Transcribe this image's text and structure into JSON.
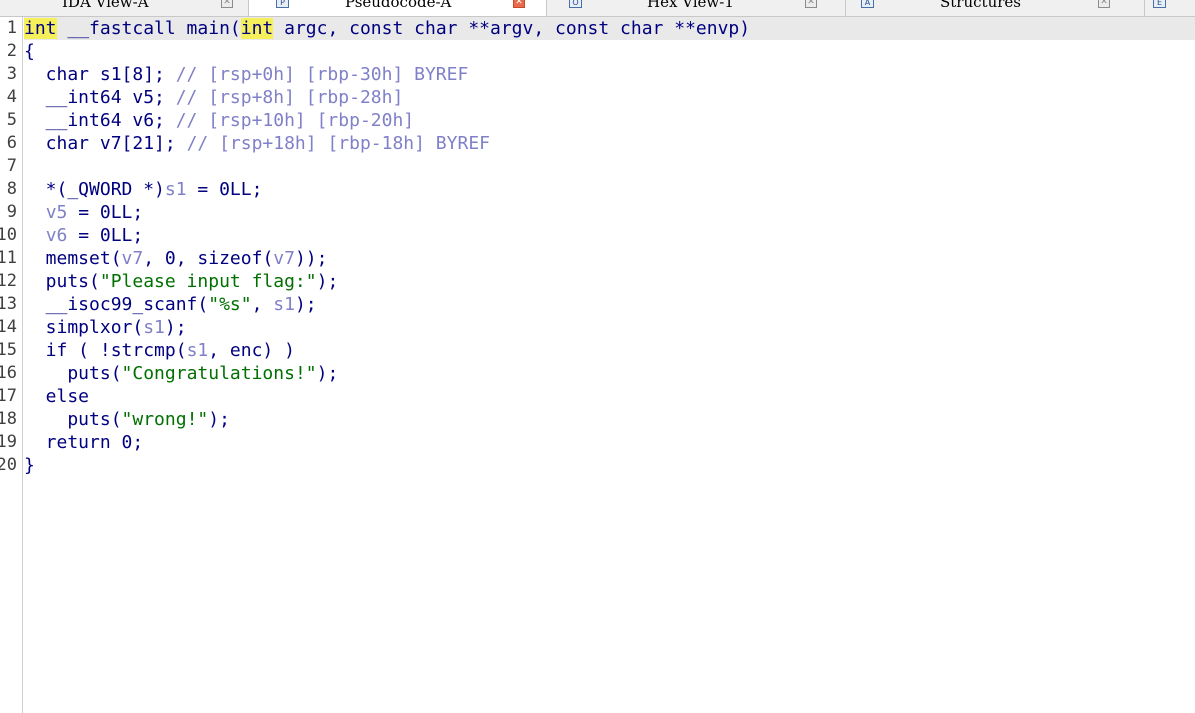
{
  "tabs": [
    {
      "label": "IDA View-A",
      "active": false
    },
    {
      "label": "Pseudocode-A",
      "active": true
    },
    {
      "label": "Hex View-1",
      "active": false
    },
    {
      "label": "Structures",
      "active": false
    }
  ],
  "tab_icons": {
    "pseudocode": "P",
    "hex": "O",
    "structures": "A",
    "enums": "E"
  },
  "colors": {
    "keyword": "#000080",
    "variable": "#8080c8",
    "string": "#007000",
    "highlight": "#f5f05a"
  },
  "line_numbers": [
    "1",
    "2",
    "3",
    "4",
    "5",
    "6",
    "7",
    "8",
    "9",
    "10",
    "11",
    "12",
    "13",
    "14",
    "15",
    "16",
    "17",
    "18",
    "19",
    "20"
  ],
  "code": {
    "l1": {
      "a": "int",
      "b": " __fastcall main(",
      "c": "int",
      "d": " argc, const char **argv, const char **envp)"
    },
    "l2": {
      "a": "{"
    },
    "l3": {
      "a": "  char s1[8]; ",
      "b": "// [rsp+0h] [rbp-30h] BYREF"
    },
    "l4": {
      "a": "  __int64 v5; ",
      "b": "// [rsp+8h] [rbp-28h]"
    },
    "l5": {
      "a": "  __int64 v6; ",
      "b": "// [rsp+10h] [rbp-20h]"
    },
    "l6": {
      "a": "  char v7[21]; ",
      "b": "// [rsp+18h] [rbp-18h] BYREF"
    },
    "l7": {
      "a": ""
    },
    "l8": {
      "a": "  *(_QWORD *)",
      "b": "s1",
      "c": " = 0LL;"
    },
    "l9": {
      "a": "  ",
      "b": "v5",
      "c": " = 0LL;"
    },
    "l10": {
      "a": "  ",
      "b": "v6",
      "c": " = 0LL;"
    },
    "l11": {
      "a": "  memset(",
      "b": "v7",
      "c": ", 0, sizeof(",
      "d": "v7",
      "e": "));"
    },
    "l12": {
      "a": "  puts(",
      "b": "\"Please input flag:\"",
      "c": ");"
    },
    "l13": {
      "a": "  __isoc99_scanf(",
      "b": "\"%s\"",
      "c": ", ",
      "d": "s1",
      "e": ");"
    },
    "l14": {
      "a": "  simplxor(",
      "b": "s1",
      "c": ");"
    },
    "l15": {
      "a": "  if ( !strcmp(",
      "b": "s1",
      "c": ", enc) )"
    },
    "l16": {
      "a": "    puts(",
      "b": "\"Congratulations!\"",
      "c": ");"
    },
    "l17": {
      "a": "  else"
    },
    "l18": {
      "a": "    puts(",
      "b": "\"wrong!\"",
      "c": ");"
    },
    "l19": {
      "a": "  return 0;"
    },
    "l20": {
      "a": "}"
    }
  }
}
